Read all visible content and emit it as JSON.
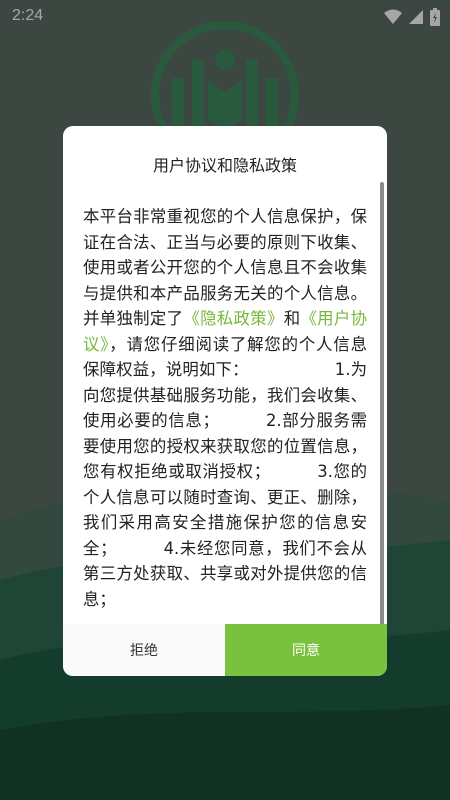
{
  "status_bar": {
    "time": "2:24",
    "icons": [
      "wifi-icon",
      "signal-icon",
      "battery-icon"
    ]
  },
  "dialog": {
    "title": "用户协议和隐私政策",
    "body_part1": "本平台非常重视您的个人信息保护，保证在合法、正当与必要的原则下收集、使用或者公开您的个人信息且不会收集与提供和本产品服务无关的个人信息。并单独制定了",
    "privacy_link": "《隐私政策》",
    "and_text": "和",
    "agreement_link": "《用户协议》",
    "body_part2": "，请您仔细阅读了解您的个人信息保障权益，说明如下：                1.为向您提供基础服务功能，我们会收集、使用必要的信息；        2.部分服务需要使用您的授权来获取您的位置信息，您有权拒绝或取消授权；        3.您的个人信息可以随时查询、更正、删除，我们采用高安全措施保护您的信息安全；        4.未经您同意，我们不会从第三方处获取、共享或对外提供您的信息；",
    "reject_label": "拒绝",
    "agree_label": "同意"
  },
  "colors": {
    "accent": "#78c23e",
    "link": "#76b83a"
  }
}
